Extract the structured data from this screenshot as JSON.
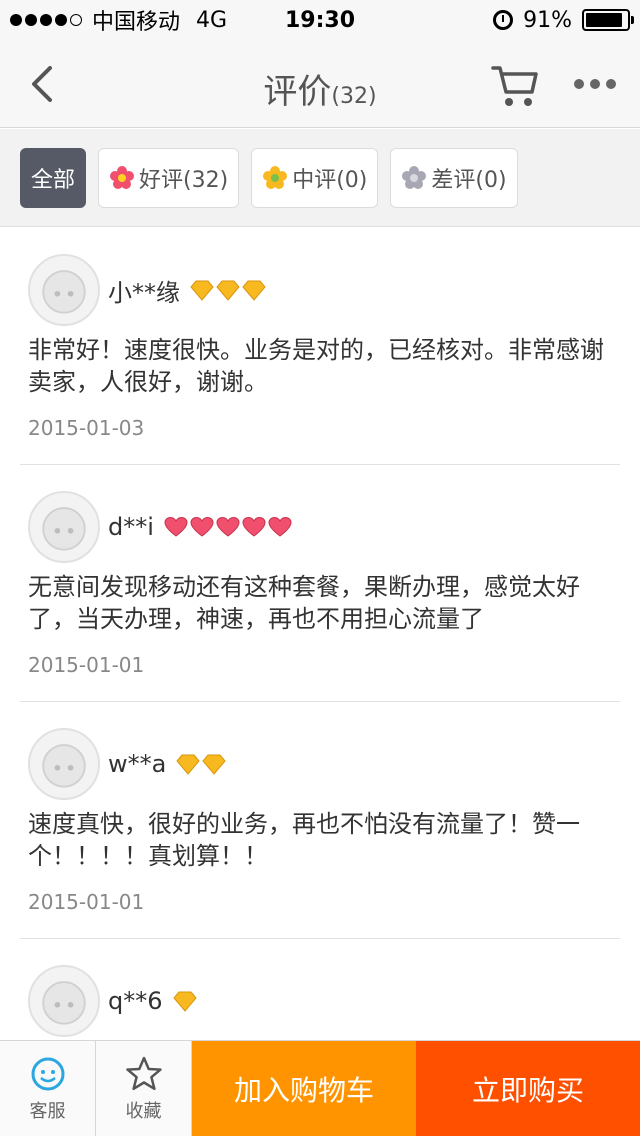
{
  "status_bar": {
    "carrier": "中国移动",
    "network": "4G",
    "time": "19:30",
    "battery": "91%",
    "battery_level": 0.91
  },
  "header": {
    "title": "评价",
    "count": "(32)"
  },
  "filters": [
    {
      "label": "全部",
      "active": true
    },
    {
      "label": "好评(32)",
      "icon": "red-flower-icon"
    },
    {
      "label": "中评(0)",
      "icon": "yellow-flower-icon"
    },
    {
      "label": "差评(0)",
      "icon": "gray-flower-icon"
    }
  ],
  "reviews": [
    {
      "user": "小**缘",
      "badge_type": "diamond",
      "badge_count": 3,
      "text": "非常好！速度很快。业务是对的，已经核对。非常感谢卖家，人很好，谢谢。",
      "date": "2015-01-03"
    },
    {
      "user": "d**i",
      "badge_type": "heart",
      "badge_count": 5,
      "text": "无意间发现移动还有这种套餐，果断办理，感觉太好了，当天办理，神速，再也不用担心流量了",
      "date": "2015-01-01"
    },
    {
      "user": "w**a",
      "badge_type": "diamond",
      "badge_count": 2,
      "text": "速度真快，很好的业务，再也不怕没有流量了！赞一个！！！！真划算！！",
      "date": "2015-01-01"
    },
    {
      "user": "q**6",
      "badge_type": "diamond",
      "badge_count": 1,
      "text": "",
      "date": ""
    }
  ],
  "bottom_bar": {
    "service_label": "客服",
    "favorite_label": "收藏",
    "add_cart_label": "加入购物车",
    "buy_now_label": "立即购买"
  },
  "colors": {
    "add_cart": "#ff9400",
    "buy_now": "#ff5000",
    "active_tab": "#555a66",
    "service_icon": "#2aa7e0"
  }
}
